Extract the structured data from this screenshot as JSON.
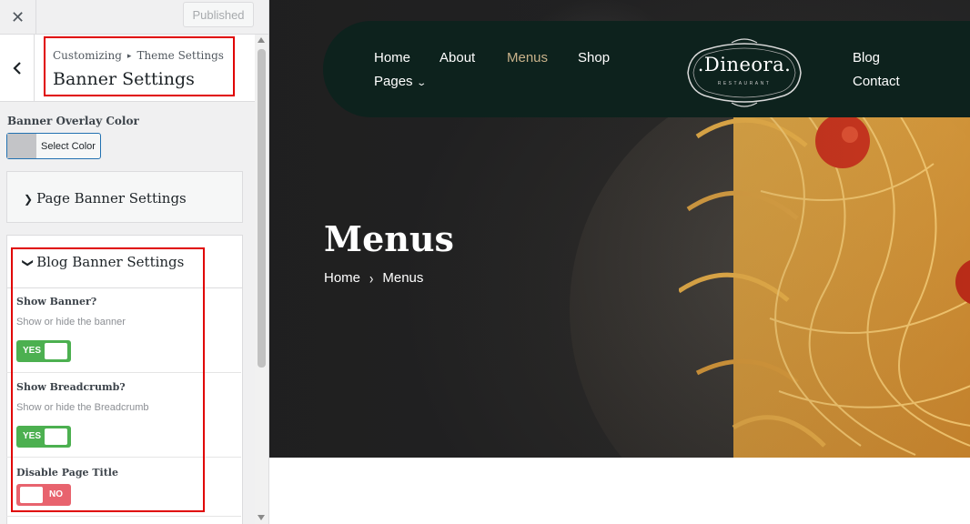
{
  "customizer": {
    "close_icon": "close-icon",
    "published_label": "Published",
    "back_icon": "chevron-left-icon",
    "breadcrumb_root": "Customizing",
    "breadcrumb_sep": "▸",
    "breadcrumb_parent": "Theme Settings",
    "section_title": "Banner Settings",
    "overlay_color_label": "Banner Overlay Color",
    "select_color_label": "Select Color",
    "page_banner_title": "Page Banner Settings",
    "blog_banner_title": "Blog Banner Settings",
    "fields": [
      {
        "label": "Show Banner?",
        "description": "Show or hide the banner",
        "toggle": "YES",
        "on": true
      },
      {
        "label": "Show Breadcrumb?",
        "description": "Show or hide the Breadcrumb",
        "toggle": "YES",
        "on": true
      },
      {
        "label": "Disable Page Title",
        "description": "",
        "toggle": "NO",
        "on": false
      }
    ],
    "highlight_color": "#e00000"
  },
  "preview": {
    "nav": {
      "home": "Home",
      "about": "About",
      "menus": "Menus",
      "shop": "Shop",
      "pages": "Pages",
      "blog": "Blog",
      "contact": "Contact",
      "active_color": "#c9b28a",
      "bar_color": "#0d221d"
    },
    "logo": {
      "name": ".Dineora.",
      "subtitle": "RESTAURANT"
    },
    "page_title": "Menus",
    "breadcrumb": {
      "home": "Home",
      "sep": "›",
      "current": "Menus"
    }
  }
}
